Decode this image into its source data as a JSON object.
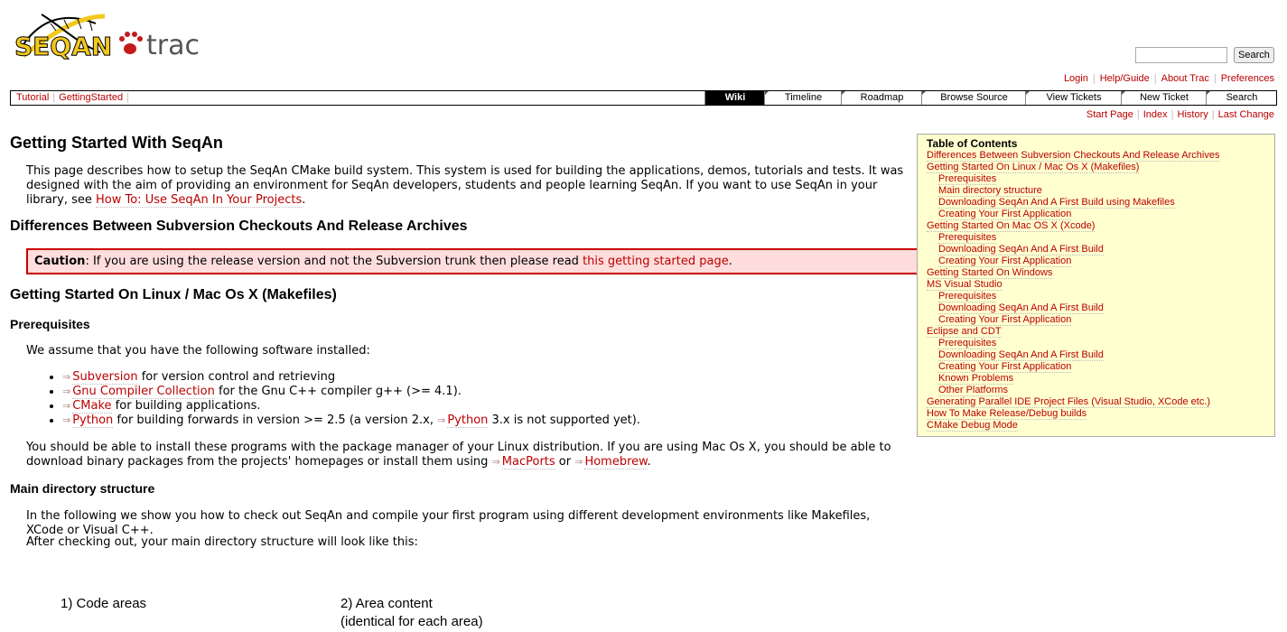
{
  "logo": {
    "name": "SEQAN",
    "paw": "paw",
    "trac": "trac"
  },
  "search": {
    "placeholder": "",
    "button_label": "Search"
  },
  "metanav": [
    "Login",
    "Help/Guide",
    "About Trac",
    "Preferences"
  ],
  "context_nav": [
    "Tutorial",
    "GettingStarted"
  ],
  "mainnav": [
    "Wiki",
    "Timeline",
    "Roadmap",
    "Browse Source",
    "View Tickets",
    "New Ticket",
    "Search"
  ],
  "subnav": [
    "Start Page",
    "Index",
    "History",
    "Last Change"
  ],
  "page": {
    "title": "Getting Started With SeqAn",
    "intro": "This page describes how to setup the SeqAn CMake build system. This system is used for building the applications, demos, tutorials and tests. It was designed with the aim of providing an environment for SeqAn developers, students and people learning SeqAn. If you want to use SeqAn in your library, see ",
    "intro_link": "How To: Use SeqAn In Your Projects",
    "intro_end": ".",
    "h_differences": "Differences Between Subversion Checkouts And Release Archives",
    "caution_label": "Caution",
    "caution_text": ": If you are using the release version and not the Subversion trunk then please read ",
    "caution_link": "this getting started page",
    "caution_end": ".",
    "h_linux": "Getting Started On Linux / Mac Os X (Makefiles)",
    "h_prereq": "Prerequisites",
    "prereq_intro": "We assume that you have the following software installed:",
    "bullets": [
      {
        "link": "Subversion",
        "text": " for version control and retrieving"
      },
      {
        "link": "Gnu Compiler Collection",
        "text": " for the Gnu C++ compiler g++ (>= 4.1)."
      },
      {
        "link": "CMake",
        "text": " for building applications."
      },
      {
        "link": "Python",
        "text": " for building forwards in version >= 2.5 (a version 2.x, ",
        "link2": "Python",
        "text2": " 3.x is not supported yet)."
      }
    ],
    "install_text": "You should be able to install these programs with the package manager of your Linux distribution. If you are using Mac Os X, you should be able to download binary packages from the projects' homepages or install them using ",
    "install_link1": "MacPorts",
    "install_or": " or ",
    "install_link2": "Homebrew",
    "install_end": ".",
    "h_main_dir": "Main directory structure",
    "main_dir_text": "In the following we show you how to check out SeqAn and compile your first program using different development environments like Makefiles, XCode or Visual C++.",
    "after_text": "After checking out, your main directory structure will look like this:",
    "diagram_label1": "1) Code areas",
    "diagram_label2a": "2) Area content",
    "diagram_label2b": "(identical for each area)"
  },
  "toc": {
    "title": "Table of Contents",
    "items": [
      {
        "level": 1,
        "label": "Differences Between Subversion Checkouts And Release Archives"
      },
      {
        "level": 1,
        "label": "Getting Started On Linux / Mac Os X (Makefiles)"
      },
      {
        "level": 2,
        "label": "Prerequisites"
      },
      {
        "level": 2,
        "label": "Main directory structure"
      },
      {
        "level": 2,
        "label": "Downloading SeqAn And A First Build using Makefiles"
      },
      {
        "level": 2,
        "label": "Creating Your First Application"
      },
      {
        "level": 1,
        "label": "Getting Started On Mac OS X (Xcode)"
      },
      {
        "level": 2,
        "label": "Prerequisites"
      },
      {
        "level": 2,
        "label": "Downloading SeqAn And A First Build"
      },
      {
        "level": 2,
        "label": "Creating Your First Application"
      },
      {
        "level": 1,
        "label": "Getting Started On Windows"
      },
      {
        "level": 1,
        "label": "MS Visual Studio"
      },
      {
        "level": 2,
        "label": "Prerequisites"
      },
      {
        "level": 2,
        "label": "Downloading SeqAn And A First Build"
      },
      {
        "level": 2,
        "label": "Creating Your First Application"
      },
      {
        "level": 1,
        "label": "Eclipse and CDT"
      },
      {
        "level": 2,
        "label": "Prerequisites"
      },
      {
        "level": 2,
        "label": "Downloading SeqAn And A First Build"
      },
      {
        "level": 2,
        "label": "Creating Your First Application"
      },
      {
        "level": 2,
        "label": "Known Problems"
      },
      {
        "level": 2,
        "label": "Other Platforms"
      },
      {
        "level": 1,
        "label": "Generating Parallel IDE Project Files (Visual Studio, XCode etc.)"
      },
      {
        "level": 1,
        "label": "How To Make Release/Debug builds"
      },
      {
        "level": 1,
        "label": "CMake Debug Mode"
      }
    ]
  },
  "colors": {
    "link": "#bb0000",
    "logo_yellow": "#f2c81c",
    "logo_red": "#c41a1a",
    "toc_bg": "#ffffd0",
    "caution_bg": "#ffdddd"
  }
}
